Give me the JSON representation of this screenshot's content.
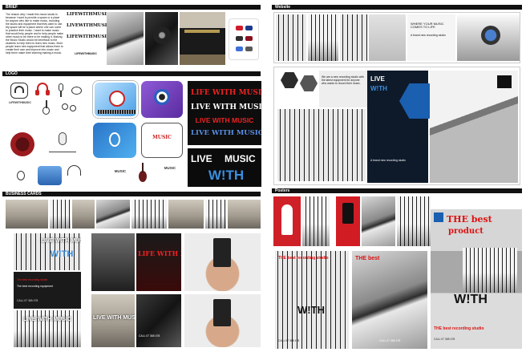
{
  "sections": {
    "brief": "BRIEF",
    "logo": "LOGO",
    "business_cards": "BUSINESS CARDS",
    "website": "Website",
    "posters": "Posters"
  },
  "brief_text": "The reason why I made this music studio is because I want to provide a space or a place for anyone who like to make music, including the studio and equipment that they want to use. My space will be a place where one can come to practice their music. I want to make music that would help people and to help people make other music to be there to be making it. Making the Music Studio would be beneficial to the students to help them to learn new music. More people learn new equipment that allows them to create their own and improve into music and help them make their learning making a music.",
  "brief_logos": [
    "LIFEWITHMUSIC",
    "LIVEWITHMUSIC",
    "LIFEWITHMUSIC"
  ],
  "brief_logo_caption": "LIFEWITHMUSIC",
  "brand": {
    "life_with_music": "LIFE WITH MUSIC",
    "live_with_music": "LIVE WITH MUSIC",
    "live": "LIVE",
    "music": "MUSIC",
    "with": "W!TH",
    "card_tagline": "The best recording studio",
    "card_tagline2": "The best recording equipment",
    "card_phone": "CALL 07 365 478"
  },
  "website": {
    "headline": "WHERE YOUR MUSIC COMES TO LIFE",
    "tagline": "A brand new recording studio",
    "body": "We are a new recording studio with the latest equipment for anyone who wants to record their music."
  },
  "posters": {
    "the_best": "THE best",
    "product": "product",
    "mark": "MUSIC",
    "sub": "THE best recording studio",
    "call": "CALL 07 365 478"
  },
  "colors": {
    "bar": "#111111",
    "red": "#dd1111",
    "blue": "#1c6fb8",
    "purple": "#7b3fc4",
    "swatches": [
      "#d11a2a",
      "#1b3a8c",
      "#2f2f2f",
      "#8a1020",
      "#3f6fd8",
      "#5a5a5a"
    ]
  }
}
